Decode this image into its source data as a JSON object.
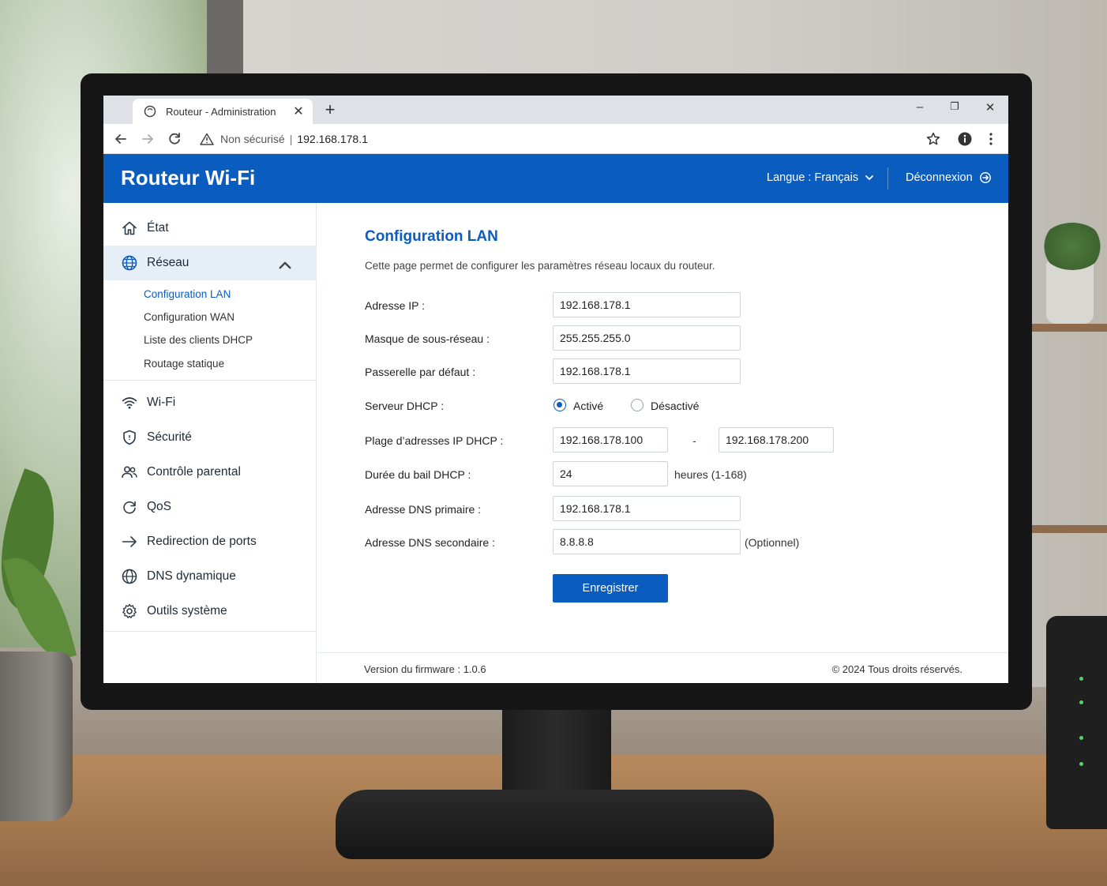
{
  "browser": {
    "tab_title": "Routeur - Administration",
    "tab_close": "✕",
    "new_tab": "+",
    "win_minimize": "–",
    "win_restore": "❐",
    "win_close": "✕",
    "not_secure": "Non sécurisé",
    "url_separator": "|",
    "url": "192.168.178.1",
    "icons": [
      "back-icon",
      "forward-icon",
      "reload-icon",
      "warning-icon",
      "star-icon",
      "profile-icon",
      "more-icon"
    ]
  },
  "header": {
    "brand": "Routeur Wi-Fi",
    "language": "Langue : Français",
    "logout": "Déconnexion",
    "color": "#0a5cbf"
  },
  "sidebar": {
    "items": [
      {
        "label": "État",
        "icon": "home-icon"
      },
      {
        "label": "Réseau",
        "icon": "globe-icon",
        "expanded": true
      },
      {
        "label": "Wi-Fi",
        "icon": "wifi-icon"
      },
      {
        "label": "Sécurité",
        "icon": "shield-icon"
      },
      {
        "label": "Contrôle parental",
        "icon": "users-icon"
      },
      {
        "label": "QoS",
        "icon": "refresh-icon"
      },
      {
        "label": "Redirection de ports",
        "icon": "arrow-right-icon"
      },
      {
        "label": "DNS dynamique",
        "icon": "globe-dns-icon"
      },
      {
        "label": "Outils système",
        "icon": "gear-icon"
      }
    ],
    "subitems": [
      {
        "label": "Configuration LAN",
        "active": true
      },
      {
        "label": "Configuration WAN"
      },
      {
        "label": "Liste des clients DHCP"
      },
      {
        "label": "Routage statique"
      }
    ]
  },
  "main": {
    "title": "Configuration LAN",
    "description": "Cette page permet de configurer les paramètres réseau locaux du routeur.",
    "fields": {
      "ip_label": "Adresse IP :",
      "ip_value": "192.168.178.1",
      "mask_label": "Masque de sous-réseau :",
      "mask_value": "255.255.255.0",
      "gateway_label": "Passerelle par défaut :",
      "gateway_value": "192.168.178.1",
      "dhcp_label": "Serveur DHCP :",
      "dhcp_on": "Activé",
      "dhcp_off": "Désactivé",
      "range_label": "Plage d’adresses IP DHCP :",
      "range_start": "192.168.178.100",
      "range_dash": "-",
      "range_end": "192.168.178.200",
      "lease_label": "Durée du bail DHCP :",
      "lease_value": "24",
      "lease_hint": "heures (1-168)",
      "dns1_label": "Adresse DNS primaire :",
      "dns1_value": "192.168.178.1",
      "dns2_label": "Adresse DNS secondaire :",
      "dns2_value": "8.8.8.8",
      "dns2_hint": "(Optionnel)"
    },
    "save_label": "Enregistrer"
  },
  "footer": {
    "firmware": "Version du firmware : 1.0.6",
    "copyright": "© 2024 Tous droits réservés."
  }
}
